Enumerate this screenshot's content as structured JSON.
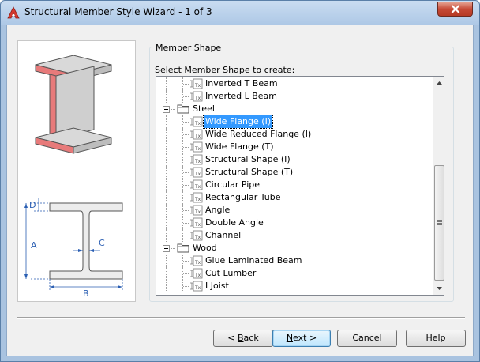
{
  "window": {
    "title": "Structural Member Style Wizard - 1 of 3"
  },
  "icons": {
    "app": "autocad-logo-icon",
    "close": "close-icon",
    "folder": "folder-icon",
    "style": "member-style-icon"
  },
  "colors": {
    "selection": "#3399ff",
    "close_button": "#c64a36",
    "dimension": "#2b5fb3",
    "beam_face": "#e77a7a"
  },
  "group": {
    "label": "Member Shape",
    "select_prefix": "S",
    "select_rest": "elect Member Shape to create:"
  },
  "diagram": {
    "labels": [
      "D",
      "A",
      "C",
      "B"
    ]
  },
  "tree": {
    "items": [
      {
        "label": "Inverted T Beam",
        "type": "shape",
        "level": 2
      },
      {
        "label": "Inverted L Beam",
        "type": "shape",
        "level": 2
      },
      {
        "label": "Steel",
        "type": "folder",
        "level": 1
      },
      {
        "label": "Wide Flange (I)",
        "type": "shape",
        "level": 2,
        "selected": true
      },
      {
        "label": "Wide Reduced Flange (I)",
        "type": "shape",
        "level": 2
      },
      {
        "label": "Wide Flange (T)",
        "type": "shape",
        "level": 2
      },
      {
        "label": "Structural Shape (I)",
        "type": "shape",
        "level": 2
      },
      {
        "label": "Structural Shape (T)",
        "type": "shape",
        "level": 2
      },
      {
        "label": "Circular Pipe",
        "type": "shape",
        "level": 2
      },
      {
        "label": "Rectangular Tube",
        "type": "shape",
        "level": 2
      },
      {
        "label": "Angle",
        "type": "shape",
        "level": 2
      },
      {
        "label": "Double Angle",
        "type": "shape",
        "level": 2
      },
      {
        "label": "Channel",
        "type": "shape",
        "level": 2
      },
      {
        "label": "Wood",
        "type": "folder",
        "level": 1
      },
      {
        "label": "Glue Laminated Beam",
        "type": "shape",
        "level": 2
      },
      {
        "label": "Cut Lumber",
        "type": "shape",
        "level": 2
      },
      {
        "label": "I Joist",
        "type": "shape",
        "level": 2
      }
    ]
  },
  "buttons": {
    "back_prefix": "< ",
    "back_key": "B",
    "back_rest": "ack",
    "next_key": "N",
    "next_rest": "ext >",
    "cancel": "Cancel",
    "help": "Help"
  }
}
